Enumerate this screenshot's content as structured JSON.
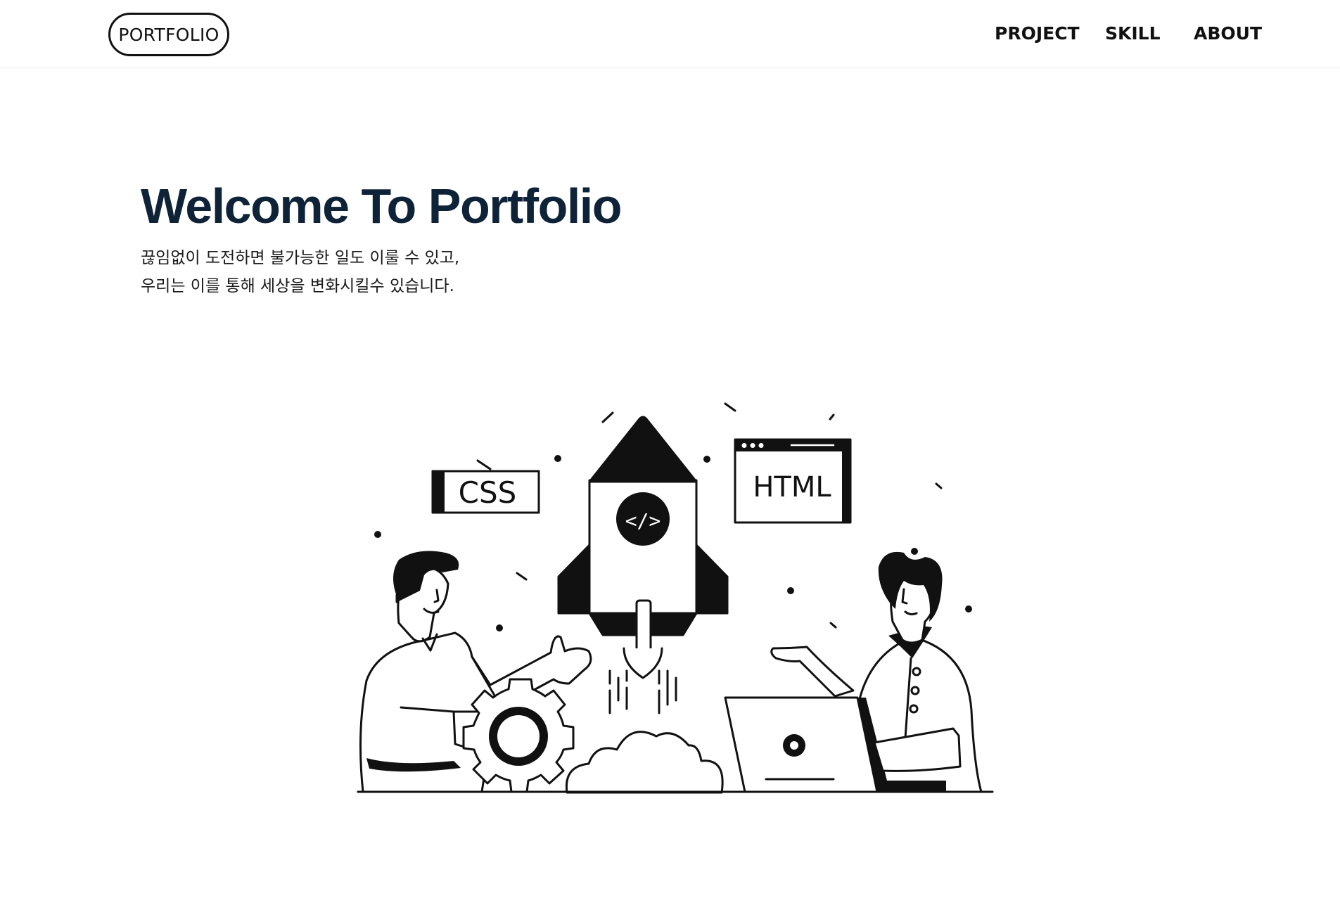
{
  "header": {
    "logo_label": "PORTFOLIO",
    "nav": [
      {
        "label": "PROJECT"
      },
      {
        "label": "SKILL"
      },
      {
        "label": "ABOUT"
      }
    ]
  },
  "hero": {
    "title": "Welcome To Portfolio",
    "subtitle_lines": [
      "끊임없이 도전하면 불가능한 일도 이룰 수 있고,",
      "우리는 이를 통해 세상을 변화시킬수 있습니다."
    ]
  },
  "illustration": {
    "css_label": "CSS",
    "html_label": "HTML",
    "code_symbol": "</>"
  },
  "colors": {
    "title": "#0e2238",
    "ink": "#111111",
    "background": "#ffffff"
  }
}
